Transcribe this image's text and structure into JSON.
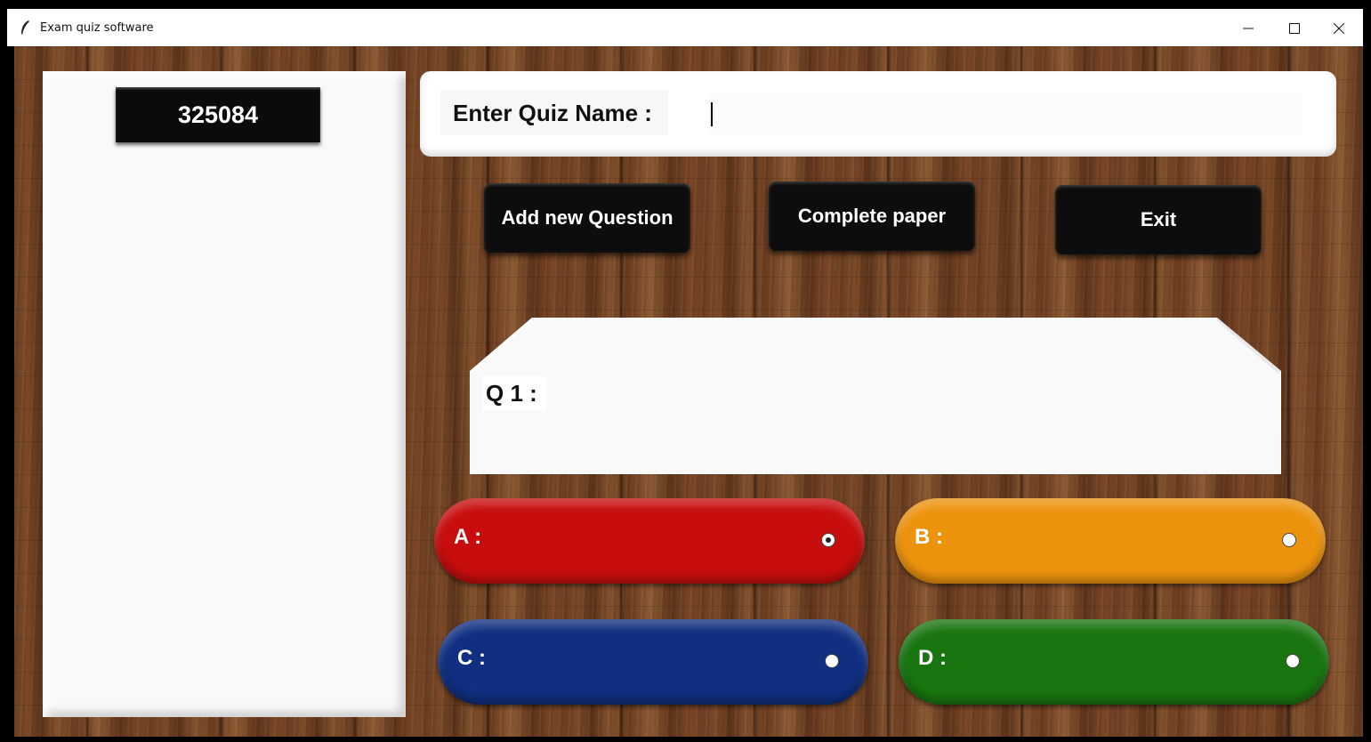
{
  "window": {
    "title": "Exam quiz software",
    "controls": {
      "minimize_icon": "minimize-icon",
      "maximize_icon": "maximize-icon",
      "close_icon": "close-icon"
    }
  },
  "sidebar": {
    "code": "325084"
  },
  "quiz_name": {
    "label": "Enter Quiz Name :",
    "value": ""
  },
  "toolbar": {
    "add_question": "Add new Question",
    "complete_paper": "Complete paper",
    "exit": "Exit"
  },
  "question": {
    "label": "Q 1 :",
    "value": ""
  },
  "options": [
    {
      "label": "A :",
      "color": "#c70d0d",
      "selected": true
    },
    {
      "label": "B :",
      "color": "#ec930e",
      "selected": false
    },
    {
      "label": "C :",
      "color": "#102f80",
      "selected": false
    },
    {
      "label": "D :",
      "color": "#197510",
      "selected": false
    }
  ],
  "colors": {
    "background_wood": "#6b3f22",
    "button_black": "#0d0d0d"
  }
}
